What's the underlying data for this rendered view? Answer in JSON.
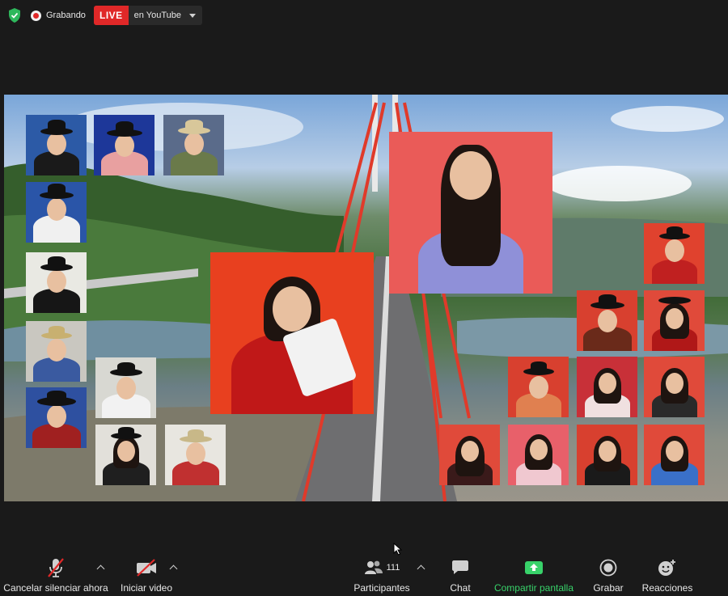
{
  "topbar": {
    "recording_label": "Grabando",
    "live_label": "LIVE",
    "live_destination": "en YouTube",
    "icons": {
      "security": "shield-check-icon",
      "recording": "record-dot-icon",
      "dropdown": "chevron-down-icon"
    },
    "colors": {
      "security": "#2eb85c",
      "live": "#e02828"
    }
  },
  "toolbar": {
    "mute_label": "Cancelar silenciar ahora",
    "video_label": "Iniciar video",
    "participants_label": "Participantes",
    "participants_count": "111",
    "chat_label": "Chat",
    "share_label": "Compartir pantalla",
    "record_label": "Grabar",
    "reactions_label": "Reacciones",
    "icons": {
      "mute": "microphone-muted-icon",
      "video": "camera-off-icon",
      "participants": "people-icon",
      "chat": "chat-bubble-icon",
      "share": "share-screen-icon",
      "record": "record-icon",
      "reactions": "smiley-plus-icon"
    },
    "colors": {
      "share": "#38d26a"
    }
  },
  "shared_screen": {
    "description_icon": "video-collage",
    "colors": {
      "tile_red": "#d8402f",
      "tile_blue": "#1f3a8a"
    }
  }
}
